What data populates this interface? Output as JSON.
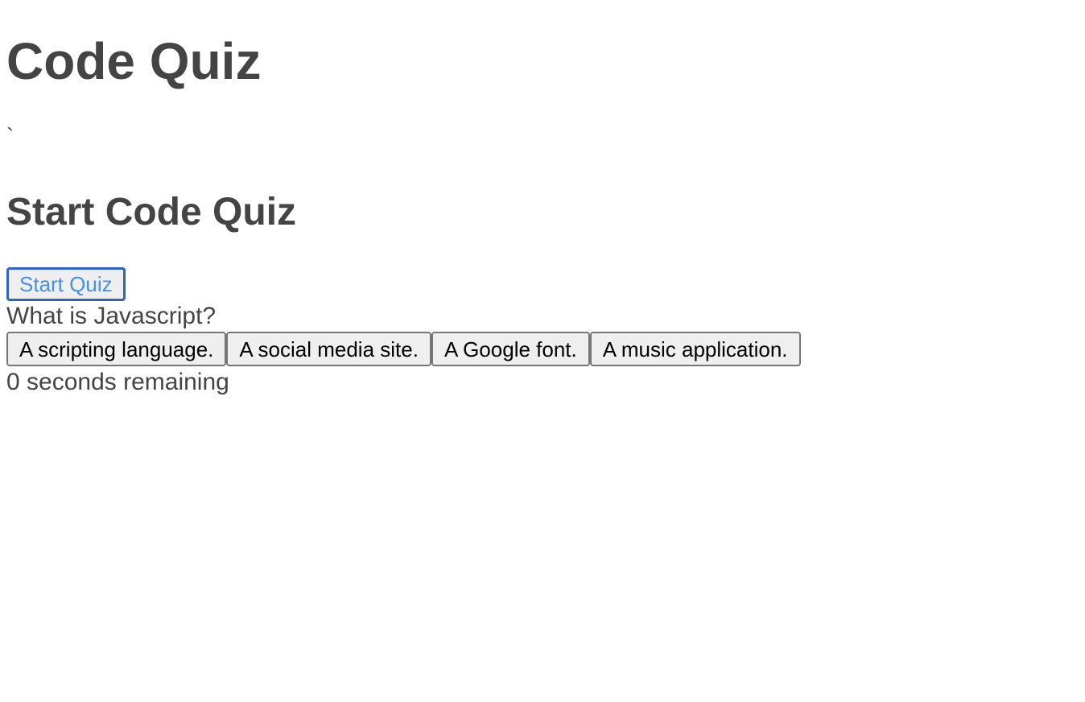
{
  "header": {
    "title": "Code Quiz",
    "stray_mark": "`"
  },
  "start": {
    "heading": "Start Code Quiz",
    "button_label": "Start Quiz"
  },
  "quiz": {
    "question": "What is Javascript?",
    "answers": [
      "A scripting language.",
      "A social media site.",
      "A Google font.",
      "A music application."
    ]
  },
  "timer": {
    "text": "0 seconds remaining"
  },
  "colors": {
    "text": "#444444",
    "button_text_accent": "#4a90e2",
    "focus_border": "#2e63c4",
    "button_bg": "#efefef"
  }
}
